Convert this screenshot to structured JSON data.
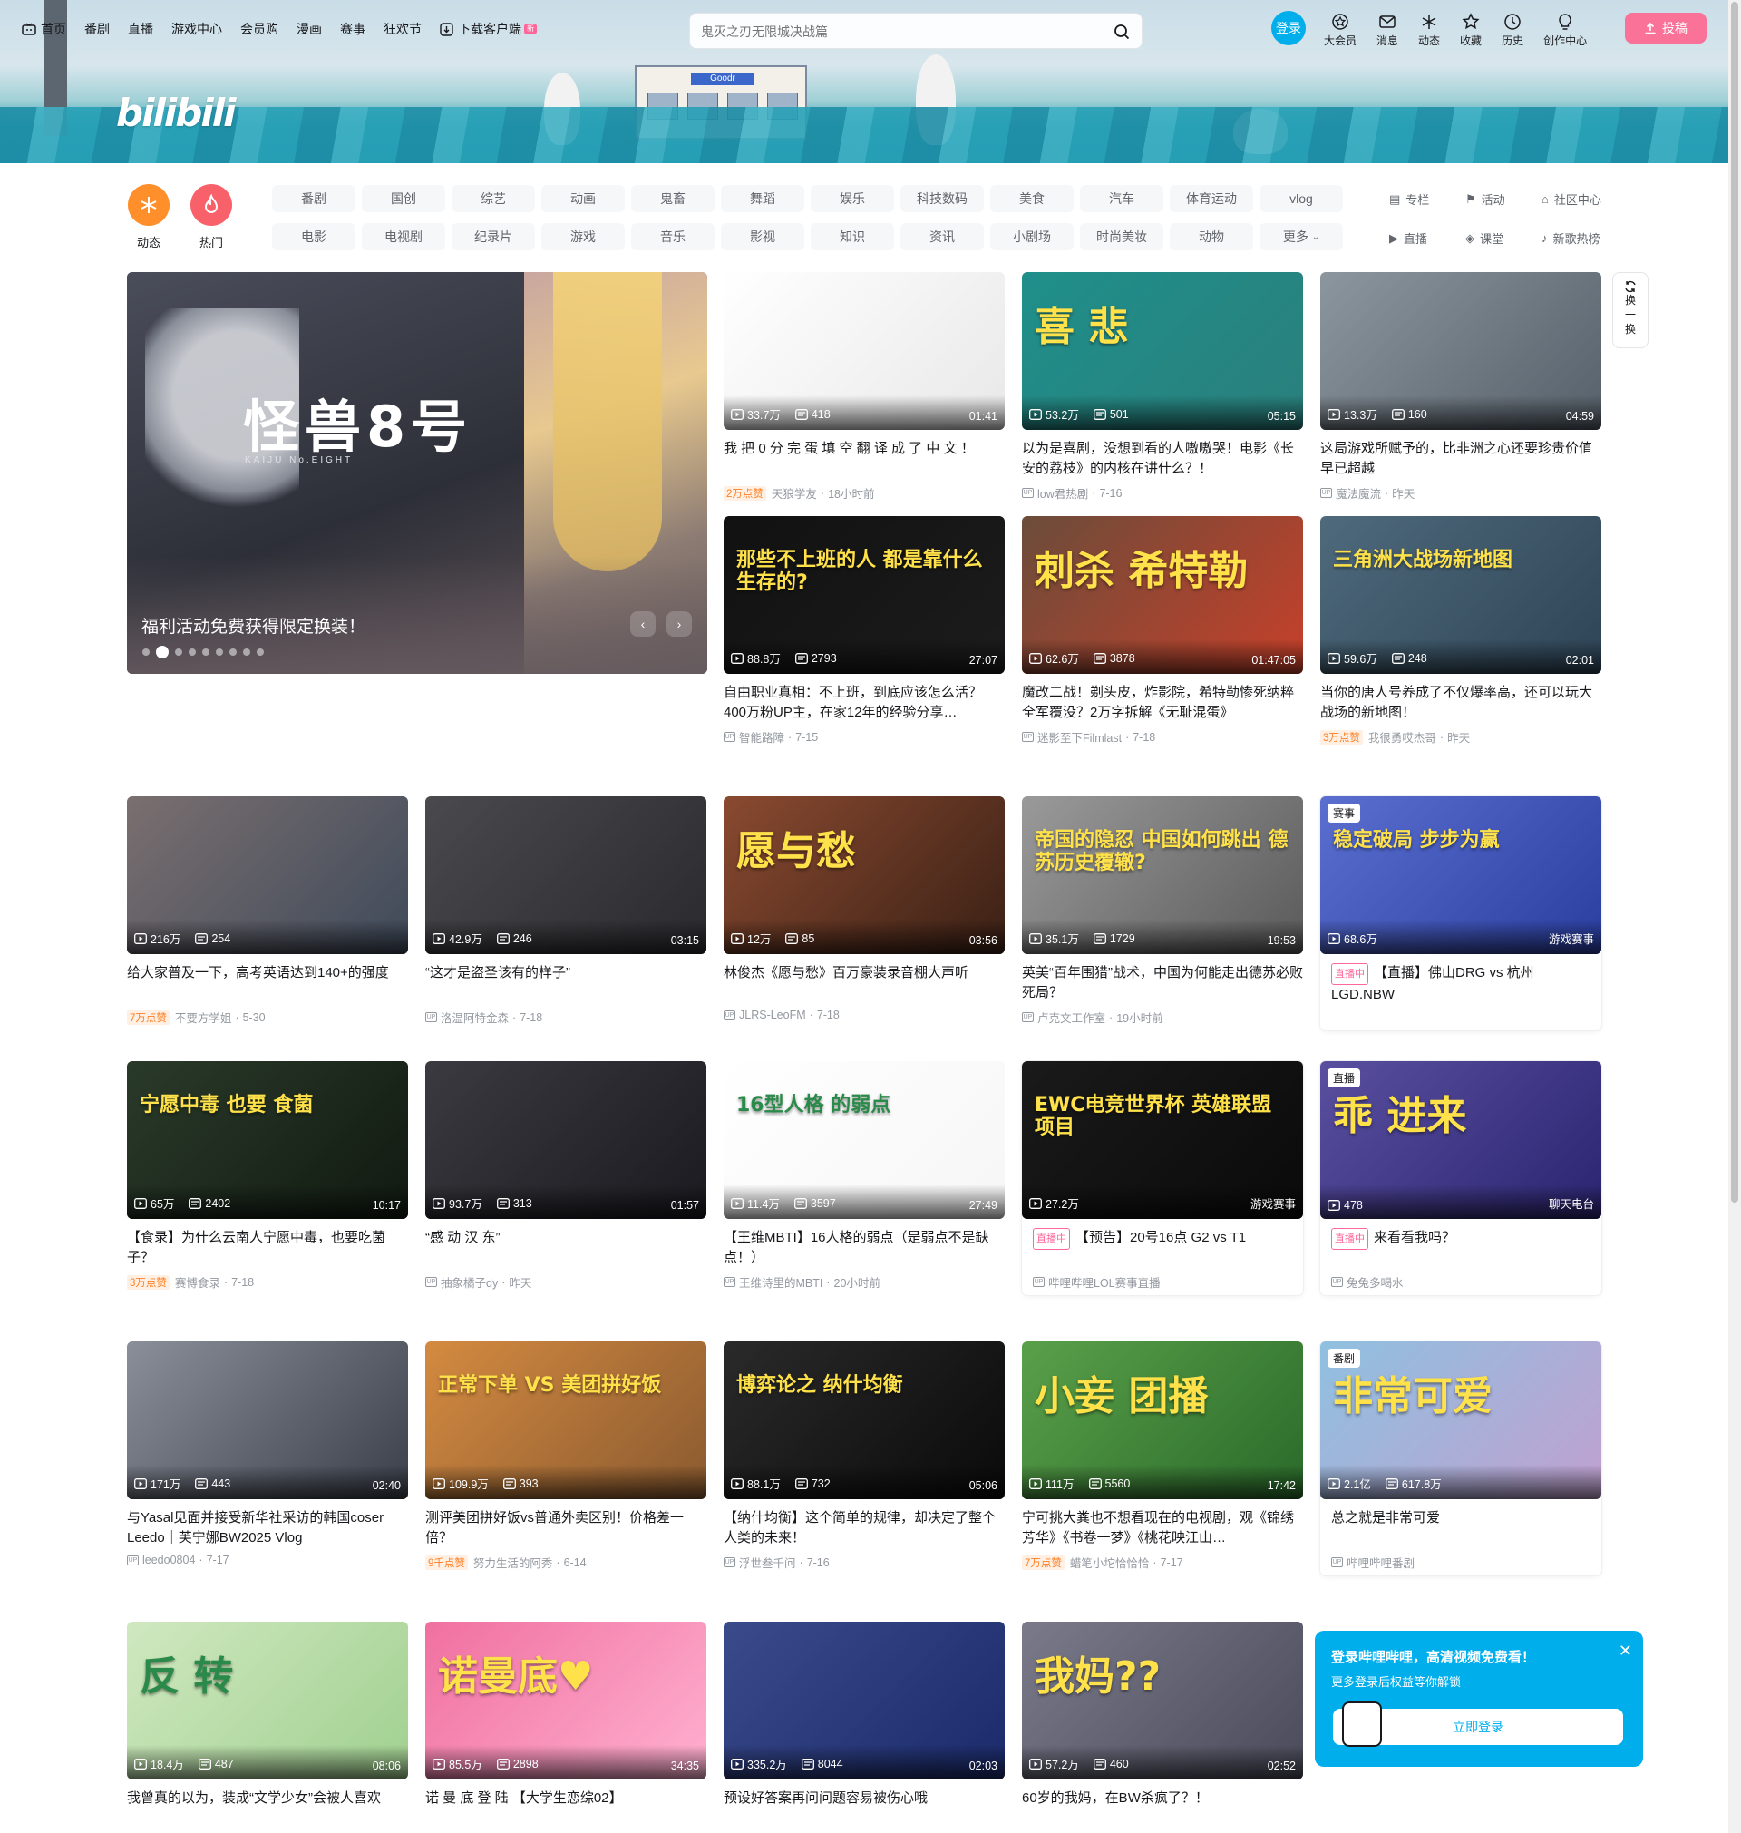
{
  "topnav": {
    "items": [
      {
        "label": "首页",
        "icon": "tv-icon"
      },
      {
        "label": "番剧"
      },
      {
        "label": "直播"
      },
      {
        "label": "游戏中心"
      },
      {
        "label": "会员购"
      },
      {
        "label": "漫画"
      },
      {
        "label": "赛事"
      },
      {
        "label": "狂欢节"
      },
      {
        "label": "下载客户端",
        "icon": "download-icon",
        "badge": "新"
      }
    ],
    "search_placeholder": "鬼灭之刃无限城决战篇",
    "login_label": "登录",
    "right_items": [
      {
        "label": "大会员",
        "icon": "vip-icon"
      },
      {
        "label": "消息",
        "icon": "message-icon"
      },
      {
        "label": "动态",
        "icon": "dynamic-icon"
      },
      {
        "label": "收藏",
        "icon": "star-icon"
      },
      {
        "label": "历史",
        "icon": "clock-icon"
      },
      {
        "label": "创作中心",
        "icon": "bulb-icon"
      }
    ],
    "upload_label": "投稿"
  },
  "banner": {
    "logo_text": "bilibili",
    "store_sign": "Goodr"
  },
  "quick": [
    {
      "label": "动态",
      "color": "#ff8f2a"
    },
    {
      "label": "热门",
      "color": "#f9616a"
    }
  ],
  "channels": [
    "番剧",
    "国创",
    "综艺",
    "动画",
    "鬼畜",
    "舞蹈",
    "娱乐",
    "科技数码",
    "美食",
    "汽车",
    "体育运动",
    "vlog",
    "电影",
    "电视剧",
    "纪录片",
    "游戏",
    "音乐",
    "影视",
    "知识",
    "资讯",
    "小剧场",
    "时尚美妆",
    "动物",
    "更多"
  ],
  "side_links": [
    {
      "label": "专栏",
      "icon": "column-icon"
    },
    {
      "label": "活动",
      "icon": "flag-icon"
    },
    {
      "label": "社区中心",
      "icon": "community-icon"
    },
    {
      "label": "直播",
      "icon": "live-icon"
    },
    {
      "label": "课堂",
      "icon": "classroom-icon"
    },
    {
      "label": "新歌热榜",
      "icon": "music-icon"
    }
  ],
  "carousel": {
    "art_title": "怪兽8号",
    "art_subtitle": "KAIJU No.EIGHT",
    "caption": "福利活动免费获得限定换装！",
    "dot_count": 9,
    "active_dot": 1
  },
  "refresh": {
    "label": [
      "换",
      "一",
      "换"
    ]
  },
  "videos": [
    {
      "views": "33.7万",
      "danmaku": "418",
      "duration": "01:41",
      "title": "我 把 0 分 完 蛋 填 空 翻 译 成 了 中 文 ！",
      "likes": "2万点赞",
      "author": "天狼学友",
      "time": "18小时前",
      "colors": [
        "#ffffff",
        "#e8e8e8"
      ],
      "art": ""
    },
    {
      "views": "53.2万",
      "danmaku": "501",
      "duration": "05:15",
      "title": "以为是喜剧，没想到看的人嗷嗷哭！电影《长安的荔枝》的内核在讲什么？！",
      "likes": "",
      "author": "low君热剧",
      "time": "7-16",
      "colors": [
        "#1f8f8a",
        "#2a7f7c"
      ],
      "art": "喜 悲"
    },
    {
      "views": "13.3万",
      "danmaku": "160",
      "duration": "04:59",
      "title": "这局游戏所赋予的，比非洲之心还要珍贵价值早已超越",
      "likes": "",
      "author": "魔法魔流",
      "time": "昨天",
      "colors": [
        "#8c969e",
        "#56606a"
      ],
      "art": ""
    },
    {
      "views": "88.8万",
      "danmaku": "2793",
      "duration": "27:07",
      "title": "自由职业真相：不上班，到底应该怎么活？400万粉UP主，在家12年的经验分享…",
      "likes": "",
      "author": "智能路障",
      "time": "7-15",
      "colors": [
        "#111111",
        "#1c1c1c"
      ],
      "art": "那些不上班的人 都是靠什么生存的?"
    },
    {
      "views": "62.6万",
      "danmaku": "3878",
      "duration": "01:47:05",
      "title": "魔改二战！剃头皮，炸影院，希特勒惨死纳粹全军覆没？2万字拆解《无耻混蛋》",
      "likes": "",
      "author": "迷影至下Filmlast",
      "time": "7-18",
      "colors": [
        "#6b4c3a",
        "#c7402a"
      ],
      "art": "刺杀 希特勒"
    },
    {
      "views": "59.6万",
      "danmaku": "248",
      "duration": "02:01",
      "title": "当你的唐人号养成了不仅爆率高，还可以玩大战场的新地图！",
      "likes": "3万点赞",
      "author": "我很勇哎杰哥",
      "time": "昨天",
      "colors": [
        "#4e6a7c",
        "#2e4456"
      ],
      "art": "三角洲大战场新地图"
    },
    {
      "views": "216万",
      "danmaku": "254",
      "duration": "",
      "title": "给大家普及一下，高考英语达到140+的强度",
      "likes": "7万点赞",
      "author": "不要方学姐",
      "time": "5-30",
      "colors": [
        "#7a6f70",
        "#3f4a5a"
      ],
      "art": ""
    },
    {
      "views": "42.9万",
      "danmaku": "246",
      "duration": "03:15",
      "title": "“这才是盗圣该有的样子”",
      "likes": "",
      "author": "洛温阿特金森",
      "time": "7-18",
      "colors": [
        "#4a4a4e",
        "#2a2a2e"
      ],
      "art": ""
    },
    {
      "views": "12万",
      "danmaku": "85",
      "duration": "03:56",
      "title": "林俊杰《愿与愁》百万豪装录音棚大声听",
      "likes": "",
      "author": "JLRS-LeoFM",
      "time": "7-18",
      "colors": [
        "#8a4a30",
        "#3a2015"
      ],
      "art": "愿与愁"
    },
    {
      "views": "35.1万",
      "danmaku": "1729",
      "duration": "19:53",
      "title": "英美“百年围猎”战术，中国为何能走出德苏必败死局？",
      "likes": "",
      "author": "卢克文工作室",
      "time": "19小时前",
      "colors": [
        "#9a9a9a",
        "#5a5a5a"
      ],
      "art": "帝国的隐忍 中国如何跳出 德苏历史覆辙?"
    },
    {
      "views": "68.6万",
      "danmaku": "",
      "duration": "游戏赛事",
      "title": "【直播】佛山DRG vs 杭州LGD.NBW",
      "likes": "",
      "author": "",
      "time": "",
      "colors": [
        "#5a6fd0",
        "#2a3ea0"
      ],
      "art": "稳定破局 步步为赢",
      "tag": "赛事",
      "live": true
    },
    {
      "views": "65万",
      "danmaku": "2402",
      "duration": "10:17",
      "title": "【食录】为什么云南人宁愿中毒，也要吃菌子？",
      "likes": "3万点赞",
      "author": "赛博食录",
      "time": "7-18",
      "colors": [
        "#2a3a2a",
        "#111a11"
      ],
      "art": "宁愿中毒 也要 食菌"
    },
    {
      "views": "93.7万",
      "danmaku": "313",
      "duration": "01:57",
      "title": "“感 动 汉 东”",
      "likes": "",
      "author": "抽象橘子dy",
      "time": "昨天",
      "colors": [
        "#3a3a40",
        "#1a1a20"
      ],
      "art": ""
    },
    {
      "views": "11.4万",
      "danmaku": "3597",
      "duration": "27:49",
      "title": "【王维MBTI】16人格的弱点（是弱点不是缺点！）",
      "likes": "",
      "author": "王维诗里的MBTI",
      "time": "20小时前",
      "colors": [
        "#ffffff",
        "#f6f6f6"
      ],
      "art": "16型人格 的弱点"
    },
    {
      "views": "27.2万",
      "danmaku": "",
      "duration": "游戏赛事",
      "title": "【预告】20号16点 G2 vs T1",
      "likes": "",
      "author": "哔哩哔哩LOL赛事直播",
      "time": "",
      "colors": [
        "#1a1a1a",
        "#0a0a0a"
      ],
      "art": "EWC电竞世界杯 英雄联盟项目",
      "live": true
    },
    {
      "views": "478",
      "danmaku": "",
      "duration": "聊天电台",
      "title": "来看看我吗？",
      "likes": "",
      "author": "兔兔多喝水",
      "time": "",
      "colors": [
        "#5a4fa0",
        "#2a2570"
      ],
      "art": "乖 进来",
      "tag": "直播",
      "live": true
    },
    {
      "views": "171万",
      "danmaku": "443",
      "duration": "02:40",
      "title": "与Yasal见面并接受新华社采访的韩国coser Leedo｜芙宁娜BW2025 Vlog",
      "likes": "",
      "author": "leedo0804",
      "time": "7-17",
      "colors": [
        "#8a8f9a",
        "#3a3f4a"
      ],
      "art": ""
    },
    {
      "views": "109.9万",
      "danmaku": "393",
      "duration": "",
      "title": "测评美团拼好饭vs普通外卖区别！价格差一倍？",
      "likes": "9千点赞",
      "author": "努力生活的阿秀",
      "time": "6-14",
      "colors": [
        "#d48a40",
        "#8a5a30"
      ],
      "art": "正常下单 VS 美团拼好饭"
    },
    {
      "views": "88.1万",
      "danmaku": "732",
      "duration": "05:06",
      "title": "【纳什均衡】这个简单的规律，却决定了整个人类的未来！",
      "likes": "",
      "author": "浮世叁千问",
      "time": "7-16",
      "colors": [
        "#2a2a2a",
        "#0a0a0a"
      ],
      "art": "博弈论之 纳什均衡"
    },
    {
      "views": "111万",
      "danmaku": "5560",
      "duration": "17:42",
      "title": "宁可挑大粪也不想看现在的电视剧，观《锦绣芳华》《书卷一梦》《桃花映江山…",
      "likes": "7万点赞",
      "author": "蜡笔小坨恰恰恰",
      "time": "7-17",
      "colors": [
        "#5aa04a",
        "#2a6a2a"
      ],
      "art": "小妾 团播"
    },
    {
      "views": "2.1亿",
      "danmaku": "617.8万",
      "duration": "",
      "title": "总之就是非常可爱",
      "likes": "",
      "author": "哔哩哔哩番剧",
      "time": "",
      "colors": [
        "#8fc0e0",
        "#c0a0d0"
      ],
      "art": "非常可爱",
      "tag": "番剧"
    },
    {
      "views": "18.4万",
      "danmaku": "487",
      "duration": "08:06",
      "title": "我曾真的以为，装成“文学少女”会被人喜欢",
      "likes": "",
      "author": "",
      "time": "",
      "colors": [
        "#d0e8c0",
        "#a0d090"
      ],
      "art": "反 转"
    },
    {
      "views": "85.5万",
      "danmaku": "2898",
      "duration": "34:35",
      "title": "诺 曼 底 登 陆 【大学生恋综02】",
      "likes": "",
      "author": "",
      "time": "",
      "colors": [
        "#f070a0",
        "#ffb0d0"
      ],
      "art": "诺曼底♥"
    },
    {
      "views": "335.2万",
      "danmaku": "8044",
      "duration": "02:03",
      "title": "预设好答案再问问题容易被伤心哦",
      "likes": "",
      "author": "",
      "time": "",
      "colors": [
        "#3a4a8a",
        "#1a2a6a"
      ],
      "art": ""
    },
    {
      "views": "57.2万",
      "danmaku": "460",
      "duration": "02:52",
      "title": "60岁的我妈，在BW杀疯了？！",
      "likes": "",
      "author": "",
      "time": "",
      "colors": [
        "#7a7a8a",
        "#4a4a5a"
      ],
      "art": "我妈??"
    }
  ],
  "popup": {
    "title": "登录哔哩哔哩，高清视频免费看！",
    "subtitle": "更多登录后权益等你解锁",
    "button": "立即登录"
  }
}
